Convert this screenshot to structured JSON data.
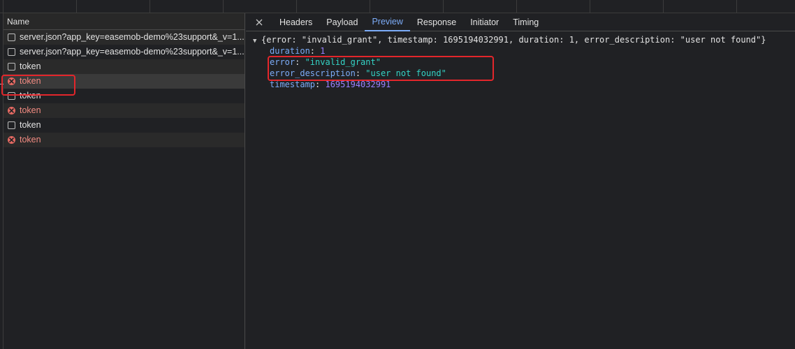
{
  "name_panel": {
    "header": "Name",
    "rows": [
      {
        "label": "server.json?app_key=easemob-demo%23support&_v=1...",
        "status": "ok"
      },
      {
        "label": "server.json?app_key=easemob-demo%23support&_v=1...",
        "status": "ok"
      },
      {
        "label": "token",
        "status": "ok"
      },
      {
        "label": "token",
        "status": "error"
      },
      {
        "label": "token",
        "status": "ok"
      },
      {
        "label": "token",
        "status": "error"
      },
      {
        "label": "token",
        "status": "ok"
      },
      {
        "label": "token",
        "status": "error"
      }
    ]
  },
  "detail": {
    "tabs": [
      "Headers",
      "Payload",
      "Preview",
      "Response",
      "Initiator",
      "Timing"
    ],
    "active_tab": "Preview",
    "summary": "{error: \"invalid_grant\", timestamp: 1695194032991, duration: 1, error_description: \"user not found\"}",
    "props": [
      {
        "key": "duration",
        "value": "1",
        "kind": "number"
      },
      {
        "key": "error",
        "value": "\"invalid_grant\"",
        "kind": "string"
      },
      {
        "key": "error_description",
        "value": "\"user not found\"",
        "kind": "string"
      },
      {
        "key": "timestamp",
        "value": "1695194032991",
        "kind": "number"
      }
    ]
  },
  "icons": {
    "close": "close-icon",
    "error": "error-circle-icon",
    "checkbox": "checkbox-icon",
    "expand": "triangle-down-icon"
  },
  "colors": {
    "accent": "#7cacf8",
    "error_text": "#f28b82",
    "highlight_box": "#e3262b",
    "number": "#9980ff",
    "string": "#5cd5fb"
  }
}
